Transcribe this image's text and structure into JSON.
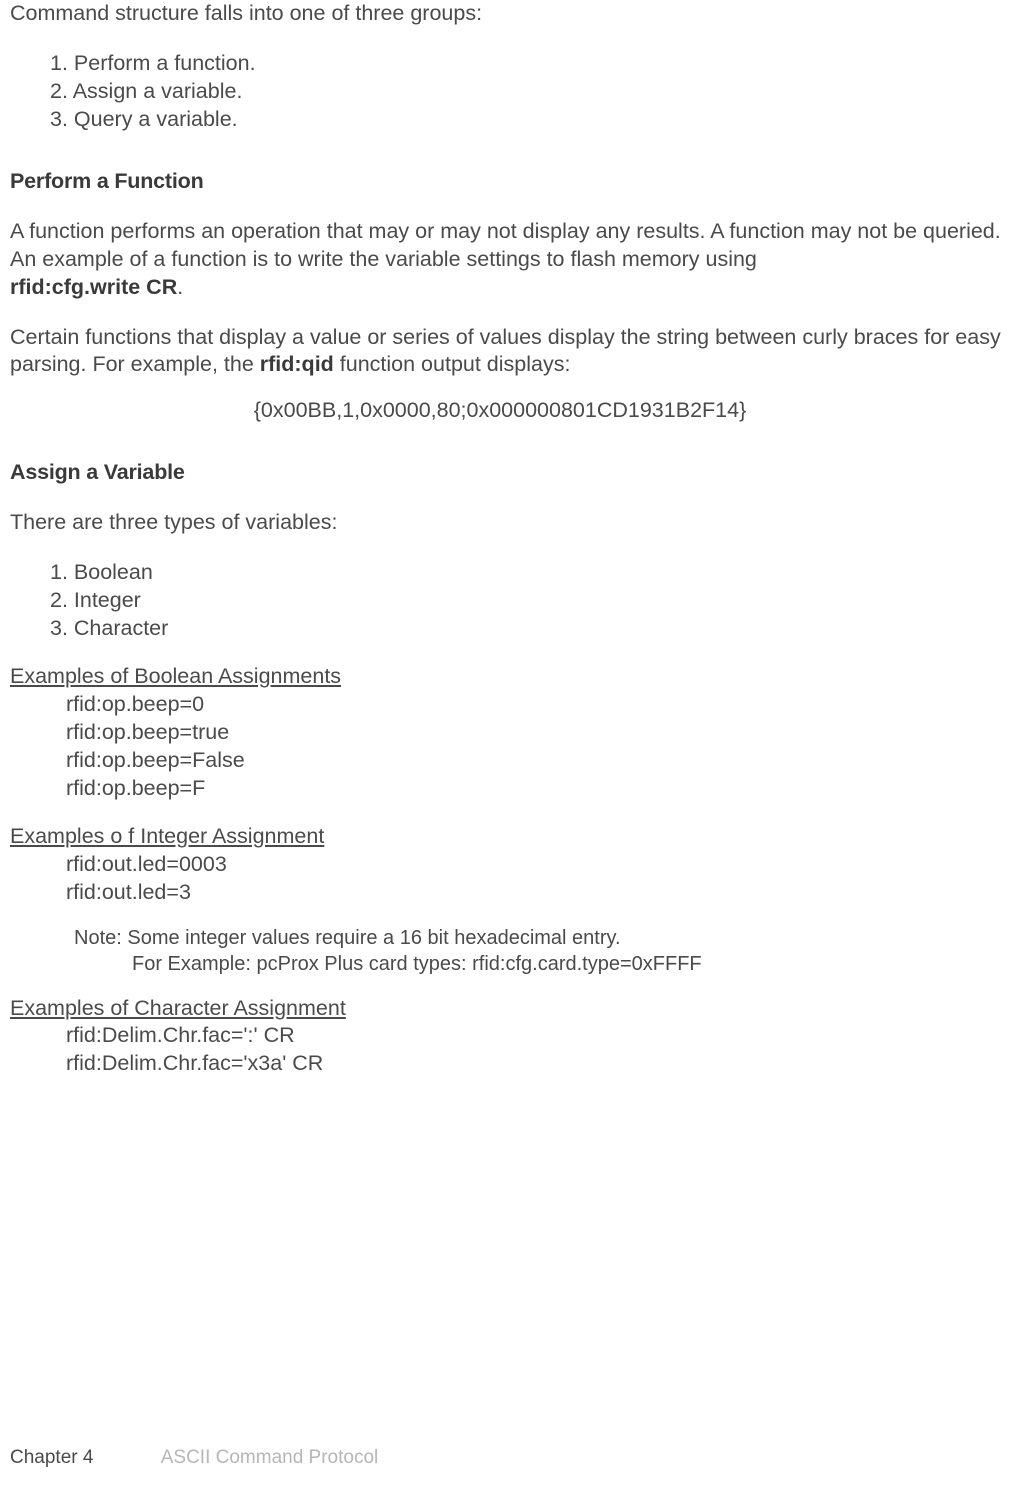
{
  "intro": "Command structure falls into one of three groups:",
  "groups": {
    "i1": "1. Perform a function.",
    "i2": "2. Assign a variable.",
    "i3": "3. Query a variable."
  },
  "section1": {
    "title": "Perform a Function",
    "p1_a": "A function performs an operation that may or may not display any results. A function may not be queried. An example of a function is to write the variable settings to flash memory using",
    "p1_b": "rfid:cfg.write CR",
    "p1_c": ".",
    "p2_a": "Certain functions that display a value or series of values display the string between curly braces for easy parsing. For example, the ",
    "p2_b": "rfid:qid",
    "p2_c": " function output displays:",
    "output": "{0x00BB,1,0x0000,80;0x000000801CD1931B2F14}"
  },
  "section2": {
    "title": "Assign a Variable",
    "intro": "There are three types of variables:",
    "types": {
      "t1": "1. Boolean",
      "t2": "2. Integer",
      "t3": "3. Character"
    },
    "bool_head": "Examples of Boolean Assignments",
    "bool": {
      "l1": "rfid:op.beep=0",
      "l2": "rfid:op.beep=true",
      "l3": "rfid:op.beep=False",
      "l4": "rfid:op.beep=F"
    },
    "int_head": "Examples o f Integer Assignment",
    "int": {
      "l1": "rfid:out.led=0003",
      "l2": "rfid:out.led=3"
    },
    "note": {
      "l1": "Note: Some integer values require a 16 bit hexadecimal entry.",
      "l2": "For Example: pcProx Plus card types: rfid:cfg.card.type=0xFFFF"
    },
    "char_head": "Examples of Character Assignment",
    "char": {
      "l1": "rfid:Delim.Chr.fac=':' CR",
      "l2": "rfid:Delim.Chr.fac='x3a' CR"
    }
  },
  "footer": {
    "chapter": "Chapter 4",
    "title": "ASCII Command Protocol"
  }
}
